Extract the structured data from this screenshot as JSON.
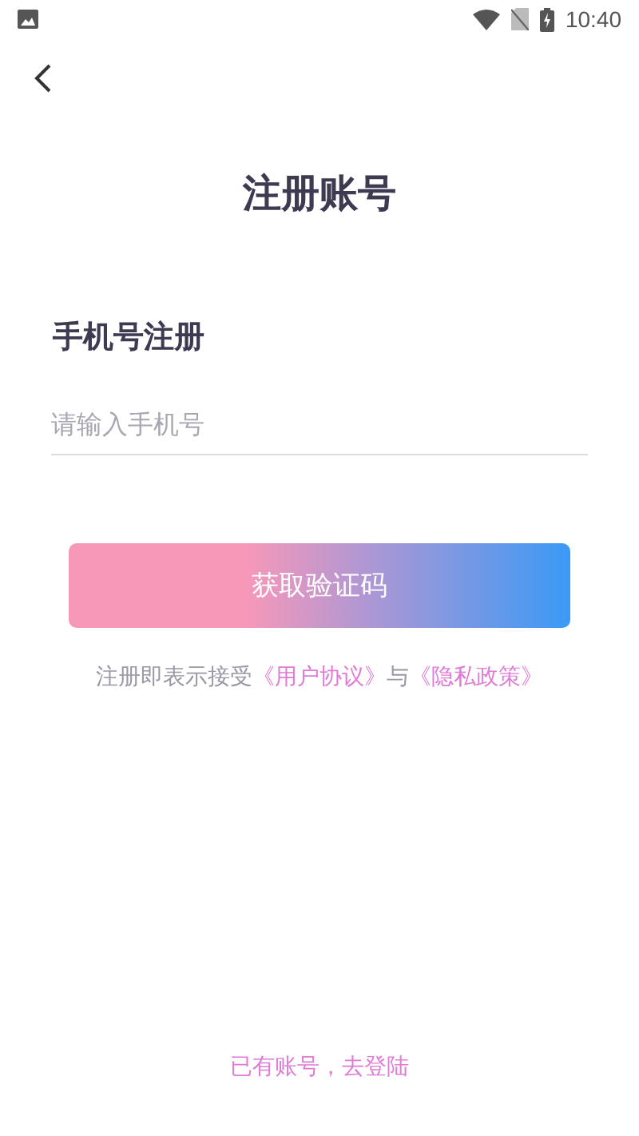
{
  "status_bar": {
    "time": "10:40"
  },
  "title": "注册账号",
  "section_title": "手机号注册",
  "phone_field": {
    "placeholder": "请输入手机号"
  },
  "submit_button": "获取验证码",
  "agreement": [
    {
      "kind": "text",
      "text": "注册即表示接受"
    },
    {
      "kind": "link",
      "text": "《用户协议》"
    },
    {
      "kind": "text",
      "text": "与"
    },
    {
      "kind": "link",
      "text": "《隐私政策》"
    }
  ],
  "login_link": "已有账号，去登陆"
}
